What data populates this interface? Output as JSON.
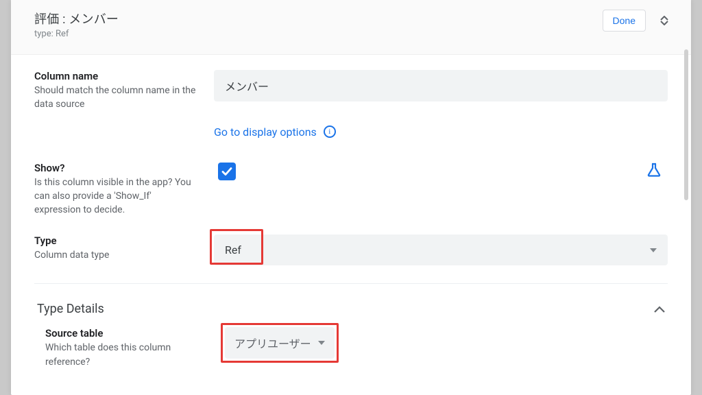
{
  "header": {
    "title": "評価 : メンバー",
    "type_prefix": "type:",
    "type_value": "Ref",
    "done_label": "Done"
  },
  "column_name": {
    "label": "Column name",
    "desc": "Should match the column name in the data source",
    "value": "メンバー"
  },
  "display_link": "Go to display options",
  "show": {
    "label": "Show?",
    "desc": "Is this column visible in the app? You can also provide a 'Show_If' expression to decide."
  },
  "type": {
    "label": "Type",
    "desc": "Column data type",
    "value": "Ref"
  },
  "type_details_title": "Type Details",
  "source_table": {
    "label": "Source table",
    "desc": "Which table does this column reference?",
    "value": "アプリユーザー"
  }
}
